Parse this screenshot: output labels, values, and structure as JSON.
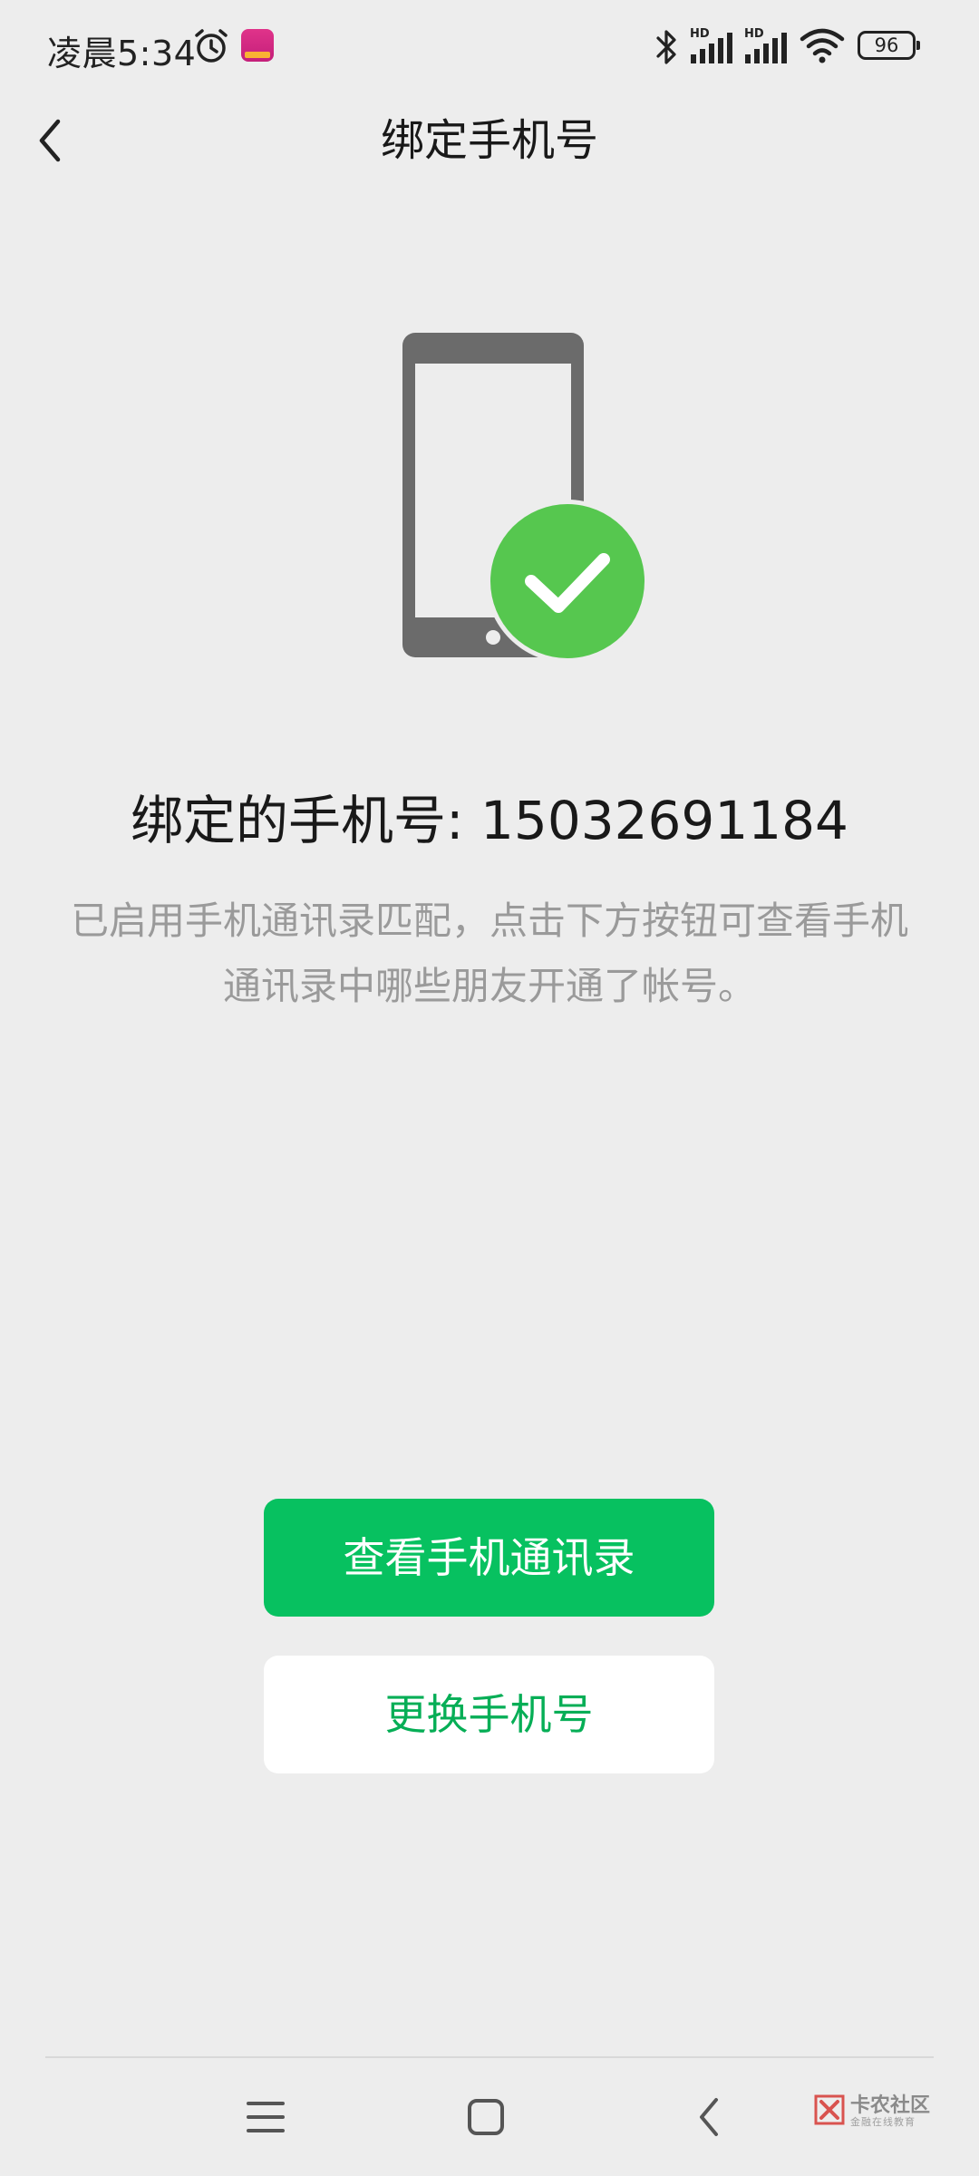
{
  "status_bar": {
    "time": "凌晨5:34",
    "hd_1": "HD",
    "hd_2": "HD",
    "battery": "96"
  },
  "header": {
    "title": "绑定手机号"
  },
  "main": {
    "bound_number": "绑定的手机号: 15032691184",
    "description": "已启用手机通讯录匹配，点击下方按钮可查看手机通讯录中哪些朋友开通了帐号。",
    "view_contacts_label": "查看手机通讯录",
    "change_phone_label": "更换手机号"
  },
  "watermark": {
    "title": "卡农社区",
    "subtitle": "金融在线教育"
  },
  "colors": {
    "primary_green": "#07c160",
    "secondary_text_green": "#06ae56",
    "background": "#ededed"
  },
  "icons": [
    "alarm-icon",
    "bluetooth-icon",
    "signal-icon",
    "wifi-icon",
    "battery-icon",
    "back-arrow-icon",
    "phone-check-icon",
    "menu-icon",
    "home-icon",
    "nav-back-icon"
  ]
}
